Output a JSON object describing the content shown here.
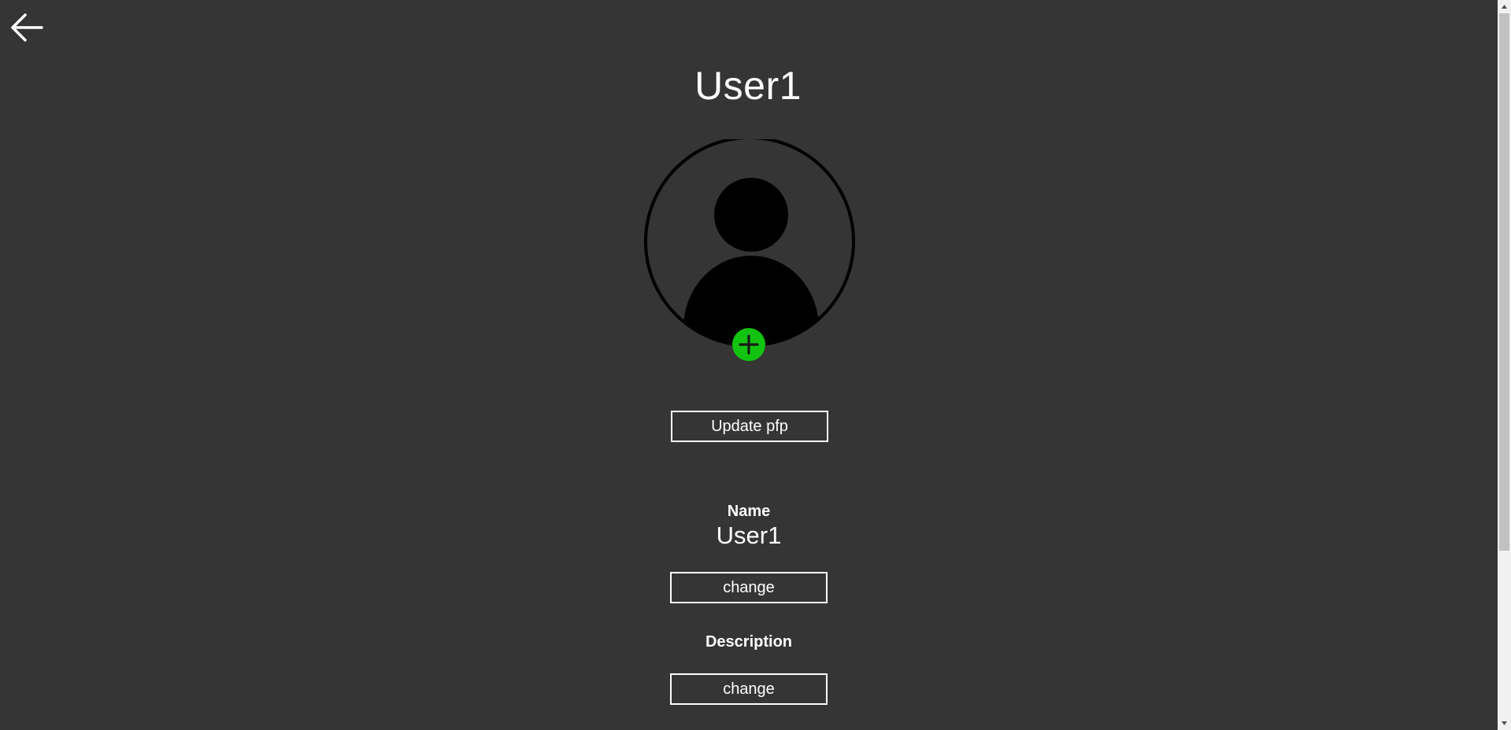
{
  "header": {
    "back_icon": "arrow-left-icon",
    "title": "User1"
  },
  "avatar": {
    "icon": "user-silhouette-icon",
    "add_icon": "plus-icon",
    "add_color": "#12c40f"
  },
  "buttons": {
    "update_pfp": "Update pfp",
    "name_change": "change",
    "description_change": "change"
  },
  "fields": {
    "name_label": "Name",
    "name_value": "User1",
    "description_label": "Description"
  },
  "theme": {
    "background": "#353535",
    "foreground": "#ffffff"
  }
}
